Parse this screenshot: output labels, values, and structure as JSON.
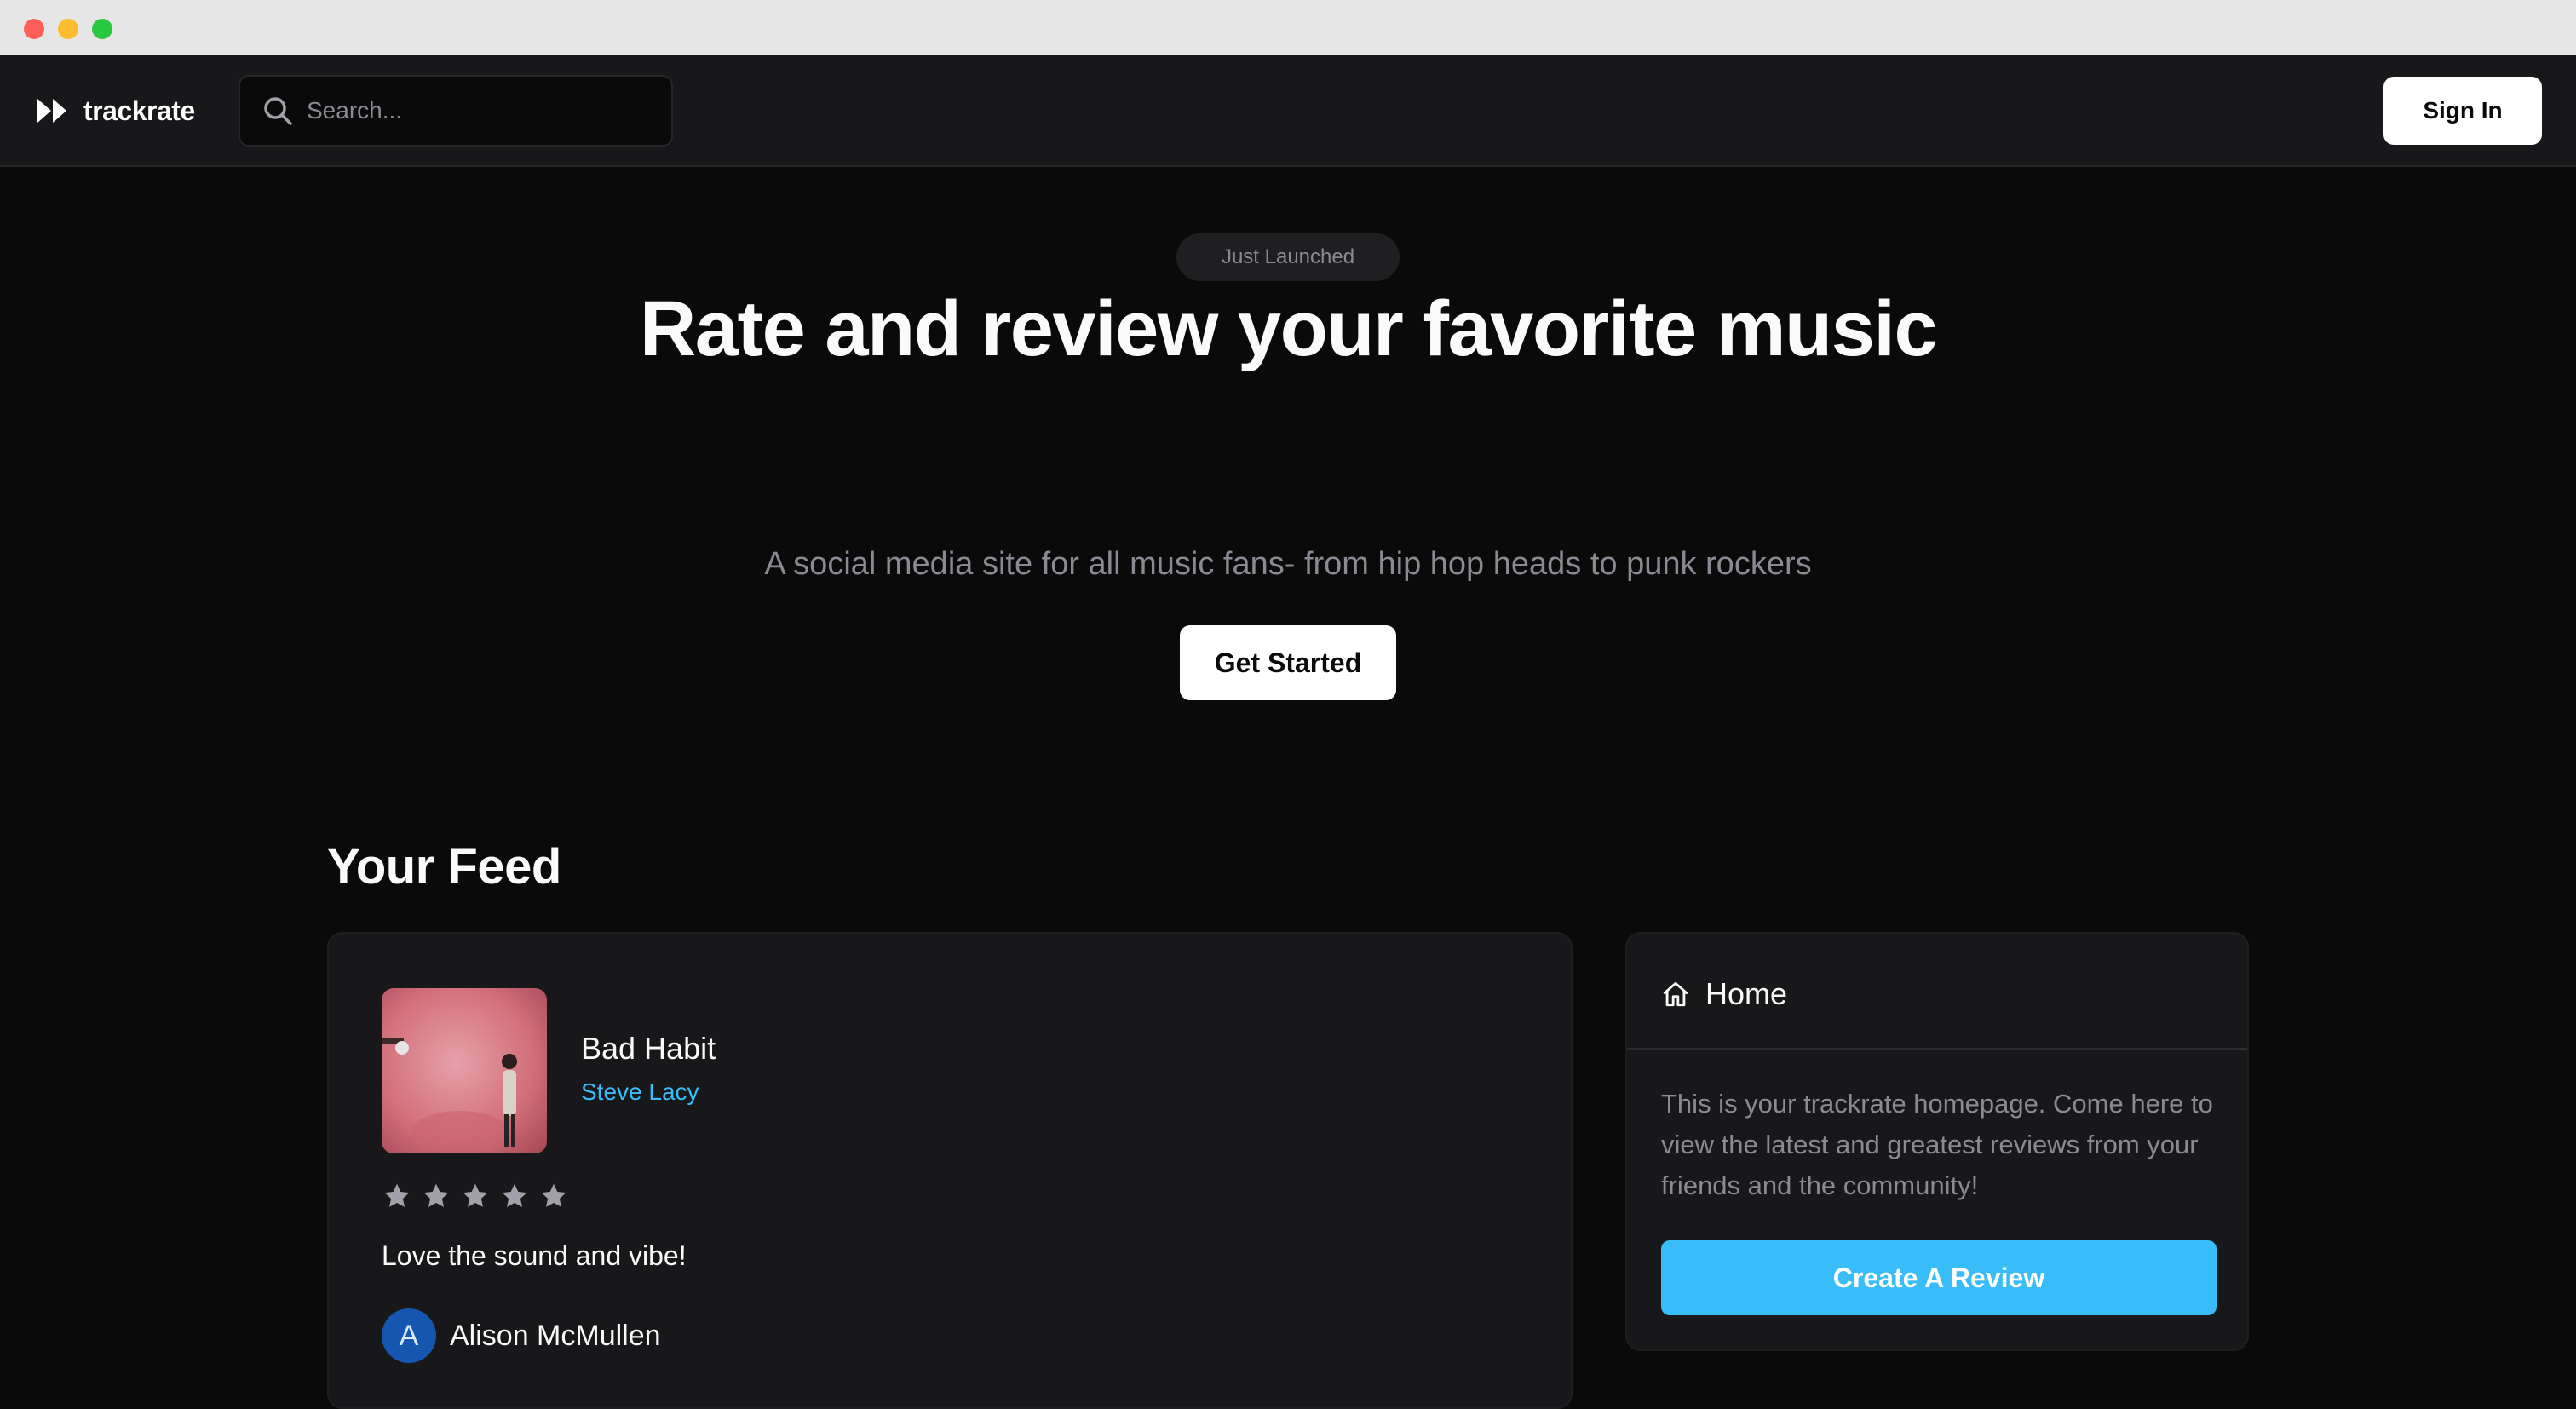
{
  "app": {
    "name": "trackrate"
  },
  "search": {
    "placeholder": "Search..."
  },
  "header": {
    "signin_label": "Sign In"
  },
  "hero": {
    "badge": "Just Launched",
    "title": "Rate and review your favorite music",
    "subtitle": "A social media site for all music fans- from hip hop heads to punk rockers",
    "cta_label": "Get Started"
  },
  "feed": {
    "title": "Your Feed",
    "reviews": [
      {
        "track": "Bad Habit",
        "artist": "Steve Lacy",
        "rating": 5,
        "max_rating": 5,
        "text": "Love the sound and vibe!",
        "reviewer_initial": "A",
        "reviewer_name": "Alison McMullen"
      }
    ]
  },
  "sidebar": {
    "title": "Home",
    "description": "This is your trackrate homepage. Come here to view the latest and greatest reviews from your friends and the community!",
    "cta_label": "Create A Review"
  },
  "colors": {
    "background": "#0a0a0b",
    "surface": "#18181b",
    "accent": "#38bdf8",
    "muted_text": "#8a8a92",
    "avatar": "#1557b0"
  },
  "icons": {
    "logo": "fast-forward-icon",
    "search": "search-icon",
    "star": "star-icon",
    "home": "home-icon"
  }
}
